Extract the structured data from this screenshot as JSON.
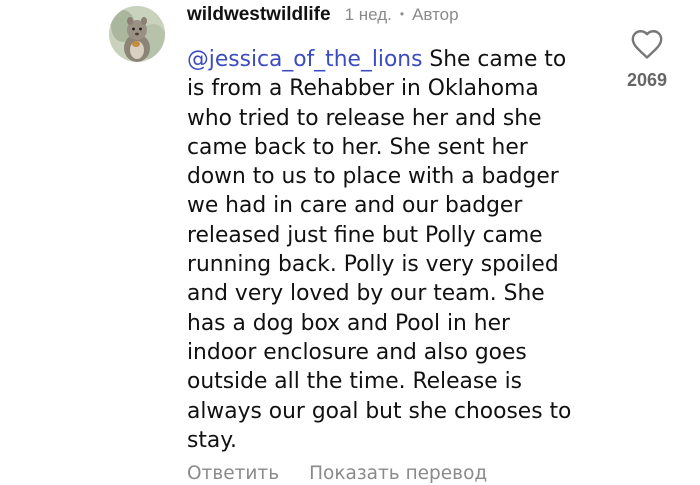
{
  "comment": {
    "username": "wildwestwildlife",
    "time": "1 нед.",
    "separator": "•",
    "author_badge": "Автор",
    "mention": "@jessica_of_the_lions",
    "text_lines": [
      " She came to",
      "is from a Rehabber in Oklahoma",
      "who tried to release her and she",
      "came back to her. She sent her",
      "down to us to place with a badger",
      "we had in care and our badger",
      "released just fine but Polly came",
      "running back. Polly is very spoiled",
      "and very loved by our team. She",
      "has a dog box and Pool in her",
      "indoor enclosure and also goes",
      "outside all the time. Release is",
      "always our goal but she chooses to",
      "stay."
    ],
    "like_count": "2069",
    "reply_label": "Ответить",
    "translate_label": "Показать перевод",
    "avatar_icon": "squirrel-avatar",
    "like_icon": "heart-icon",
    "colors": {
      "mention": "#3b4cc0",
      "secondary_text": "#8a8a8a",
      "count": "#666666"
    }
  }
}
